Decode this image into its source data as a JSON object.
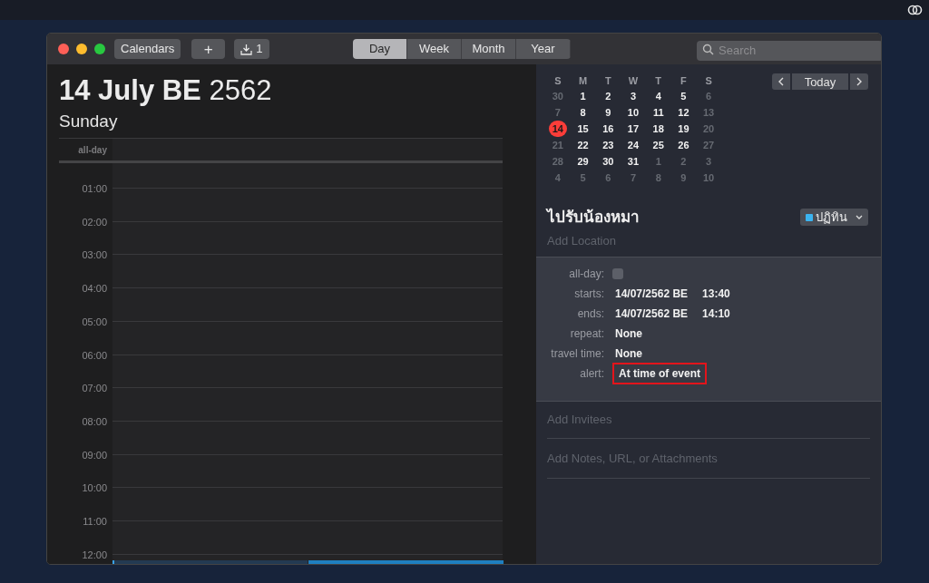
{
  "toolbar": {
    "calendars_button": "Calendars",
    "add_button": "+",
    "inbox_button": "1",
    "views": [
      {
        "label": "Day",
        "selected": true
      },
      {
        "label": "Week",
        "selected": false
      },
      {
        "label": "Month",
        "selected": false
      },
      {
        "label": "Year",
        "selected": false
      }
    ],
    "search": {
      "placeholder": "Search"
    }
  },
  "day_view": {
    "date_bold": "14 July BE",
    "year": "2562",
    "weekday": "Sunday",
    "all_day_label": "all-day",
    "hours": [
      "01:00",
      "02:00",
      "03:00",
      "04:00",
      "05:00",
      "06:00",
      "07:00",
      "08:00",
      "09:00",
      "10:00",
      "11:00",
      "12:00"
    ],
    "events": [
      {
        "selected": false
      },
      {
        "selected": true
      }
    ]
  },
  "mini_calendar": {
    "weekdays": [
      "S",
      "M",
      "T",
      "W",
      "T",
      "F",
      "S"
    ],
    "today_button": "Today",
    "days": [
      {
        "label": "30",
        "muted": true,
        "selected": false
      },
      {
        "label": "1",
        "muted": false,
        "selected": false
      },
      {
        "label": "2",
        "muted": false,
        "selected": false
      },
      {
        "label": "3",
        "muted": false,
        "selected": false
      },
      {
        "label": "4",
        "muted": false,
        "selected": false
      },
      {
        "label": "5",
        "muted": false,
        "selected": false
      },
      {
        "label": "6",
        "muted": true,
        "selected": false
      },
      {
        "label": "7",
        "muted": true,
        "selected": false
      },
      {
        "label": "8",
        "muted": false,
        "selected": false
      },
      {
        "label": "9",
        "muted": false,
        "selected": false
      },
      {
        "label": "10",
        "muted": false,
        "selected": false
      },
      {
        "label": "11",
        "muted": false,
        "selected": false
      },
      {
        "label": "12",
        "muted": false,
        "selected": false
      },
      {
        "label": "13",
        "muted": true,
        "selected": false
      },
      {
        "label": "14",
        "muted": false,
        "selected": true
      },
      {
        "label": "15",
        "muted": false,
        "selected": false
      },
      {
        "label": "16",
        "muted": false,
        "selected": false
      },
      {
        "label": "17",
        "muted": false,
        "selected": false
      },
      {
        "label": "18",
        "muted": false,
        "selected": false
      },
      {
        "label": "19",
        "muted": false,
        "selected": false
      },
      {
        "label": "20",
        "muted": true,
        "selected": false
      },
      {
        "label": "21",
        "muted": true,
        "selected": false
      },
      {
        "label": "22",
        "muted": false,
        "selected": false
      },
      {
        "label": "23",
        "muted": false,
        "selected": false
      },
      {
        "label": "24",
        "muted": false,
        "selected": false
      },
      {
        "label": "25",
        "muted": false,
        "selected": false
      },
      {
        "label": "26",
        "muted": false,
        "selected": false
      },
      {
        "label": "27",
        "muted": true,
        "selected": false
      },
      {
        "label": "28",
        "muted": true,
        "selected": false
      },
      {
        "label": "29",
        "muted": false,
        "selected": false
      },
      {
        "label": "30",
        "muted": false,
        "selected": false
      },
      {
        "label": "31",
        "muted": false,
        "selected": false
      },
      {
        "label": "1",
        "muted": true,
        "selected": false
      },
      {
        "label": "2",
        "muted": true,
        "selected": false
      },
      {
        "label": "3",
        "muted": true,
        "selected": false
      },
      {
        "label": "4",
        "muted": true,
        "selected": false
      },
      {
        "label": "5",
        "muted": true,
        "selected": false
      },
      {
        "label": "6",
        "muted": true,
        "selected": false
      },
      {
        "label": "7",
        "muted": true,
        "selected": false
      },
      {
        "label": "8",
        "muted": true,
        "selected": false
      },
      {
        "label": "9",
        "muted": true,
        "selected": false
      },
      {
        "label": "10",
        "muted": true,
        "selected": false
      }
    ]
  },
  "event": {
    "title": "ไปรับน้องหมา",
    "calendar": {
      "label": "ปฏิทิน",
      "color": "#3bb4f0"
    },
    "location_placeholder": "Add Location",
    "fields": [
      {
        "kind": "checkbox",
        "label": "all-day:",
        "checked": false
      },
      {
        "kind": "datetime",
        "label": "starts:",
        "date": "14/07/2562 BE",
        "time": "13:40"
      },
      {
        "kind": "datetime",
        "label": "ends:",
        "date": "14/07/2562 BE",
        "time": "14:10"
      },
      {
        "kind": "text",
        "label": "repeat:",
        "value": "None",
        "highlighted": false
      },
      {
        "kind": "text",
        "label": "travel time:",
        "value": "None",
        "highlighted": false
      },
      {
        "kind": "text",
        "label": "alert:",
        "value": "At time of event",
        "highlighted": true
      }
    ],
    "invitees_placeholder": "Add Invitees",
    "notes_placeholder": "Add Notes, URL, or Attachments"
  }
}
